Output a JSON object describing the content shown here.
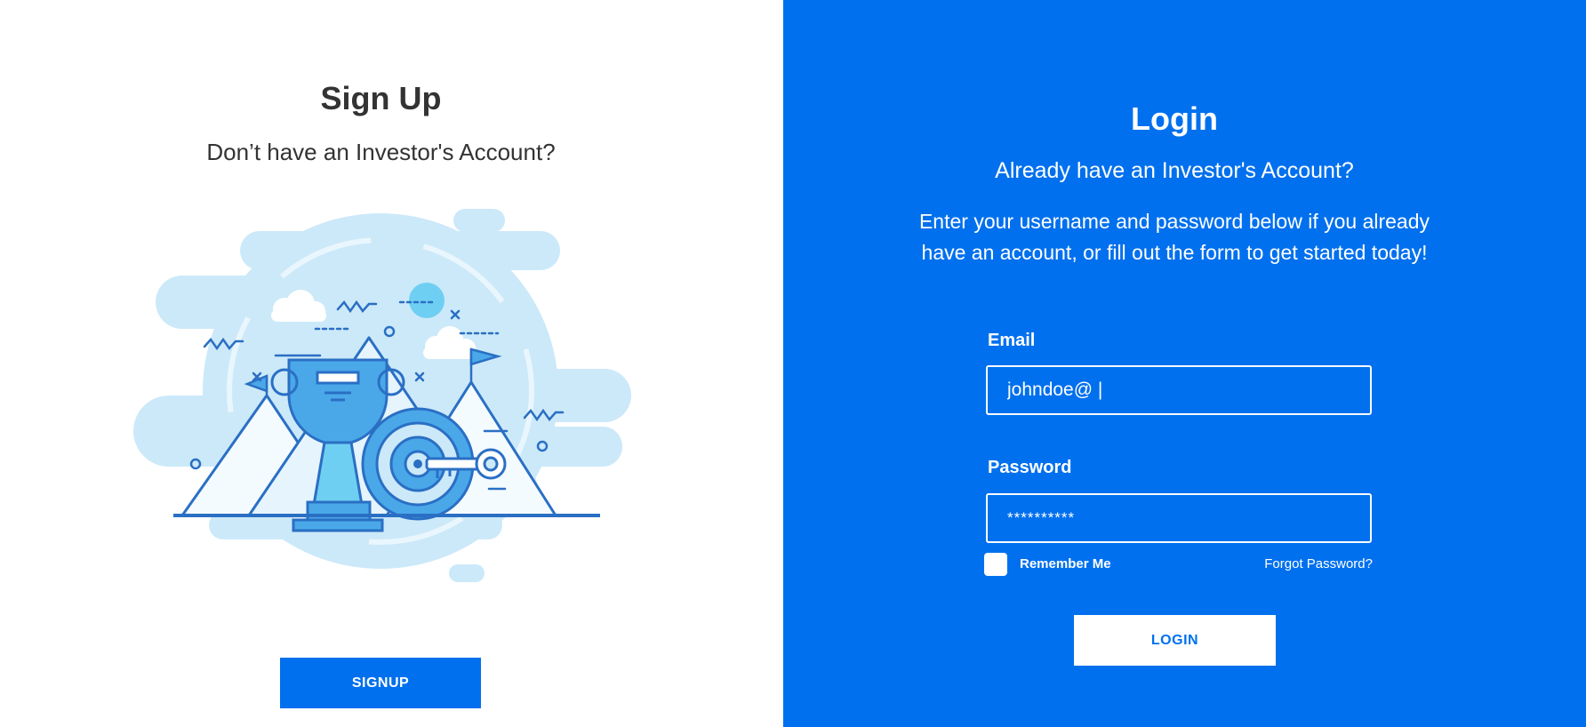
{
  "signup": {
    "title": "Sign Up",
    "subtitle": "Don’t have an Investor's Account?",
    "button_label": "SIGNUP"
  },
  "login": {
    "title": "Login",
    "subtitle": "Already have an Investor's Account?",
    "description": "Enter your username and password below if you already have an account, or fill out the form to get started today!",
    "email_label": "Email",
    "email_value": "johndoe@ |",
    "password_label": "Password",
    "password_value": "**********",
    "remember_label": "Remember Me",
    "forgot_label": "Forgot Password?",
    "button_label": "LOGIN"
  },
  "colors": {
    "brand_blue": "#0070ee",
    "illustration_light": "#cce9f9",
    "illustration_mid": "#4aa8e8",
    "illustration_stroke": "#2a6fc4"
  }
}
